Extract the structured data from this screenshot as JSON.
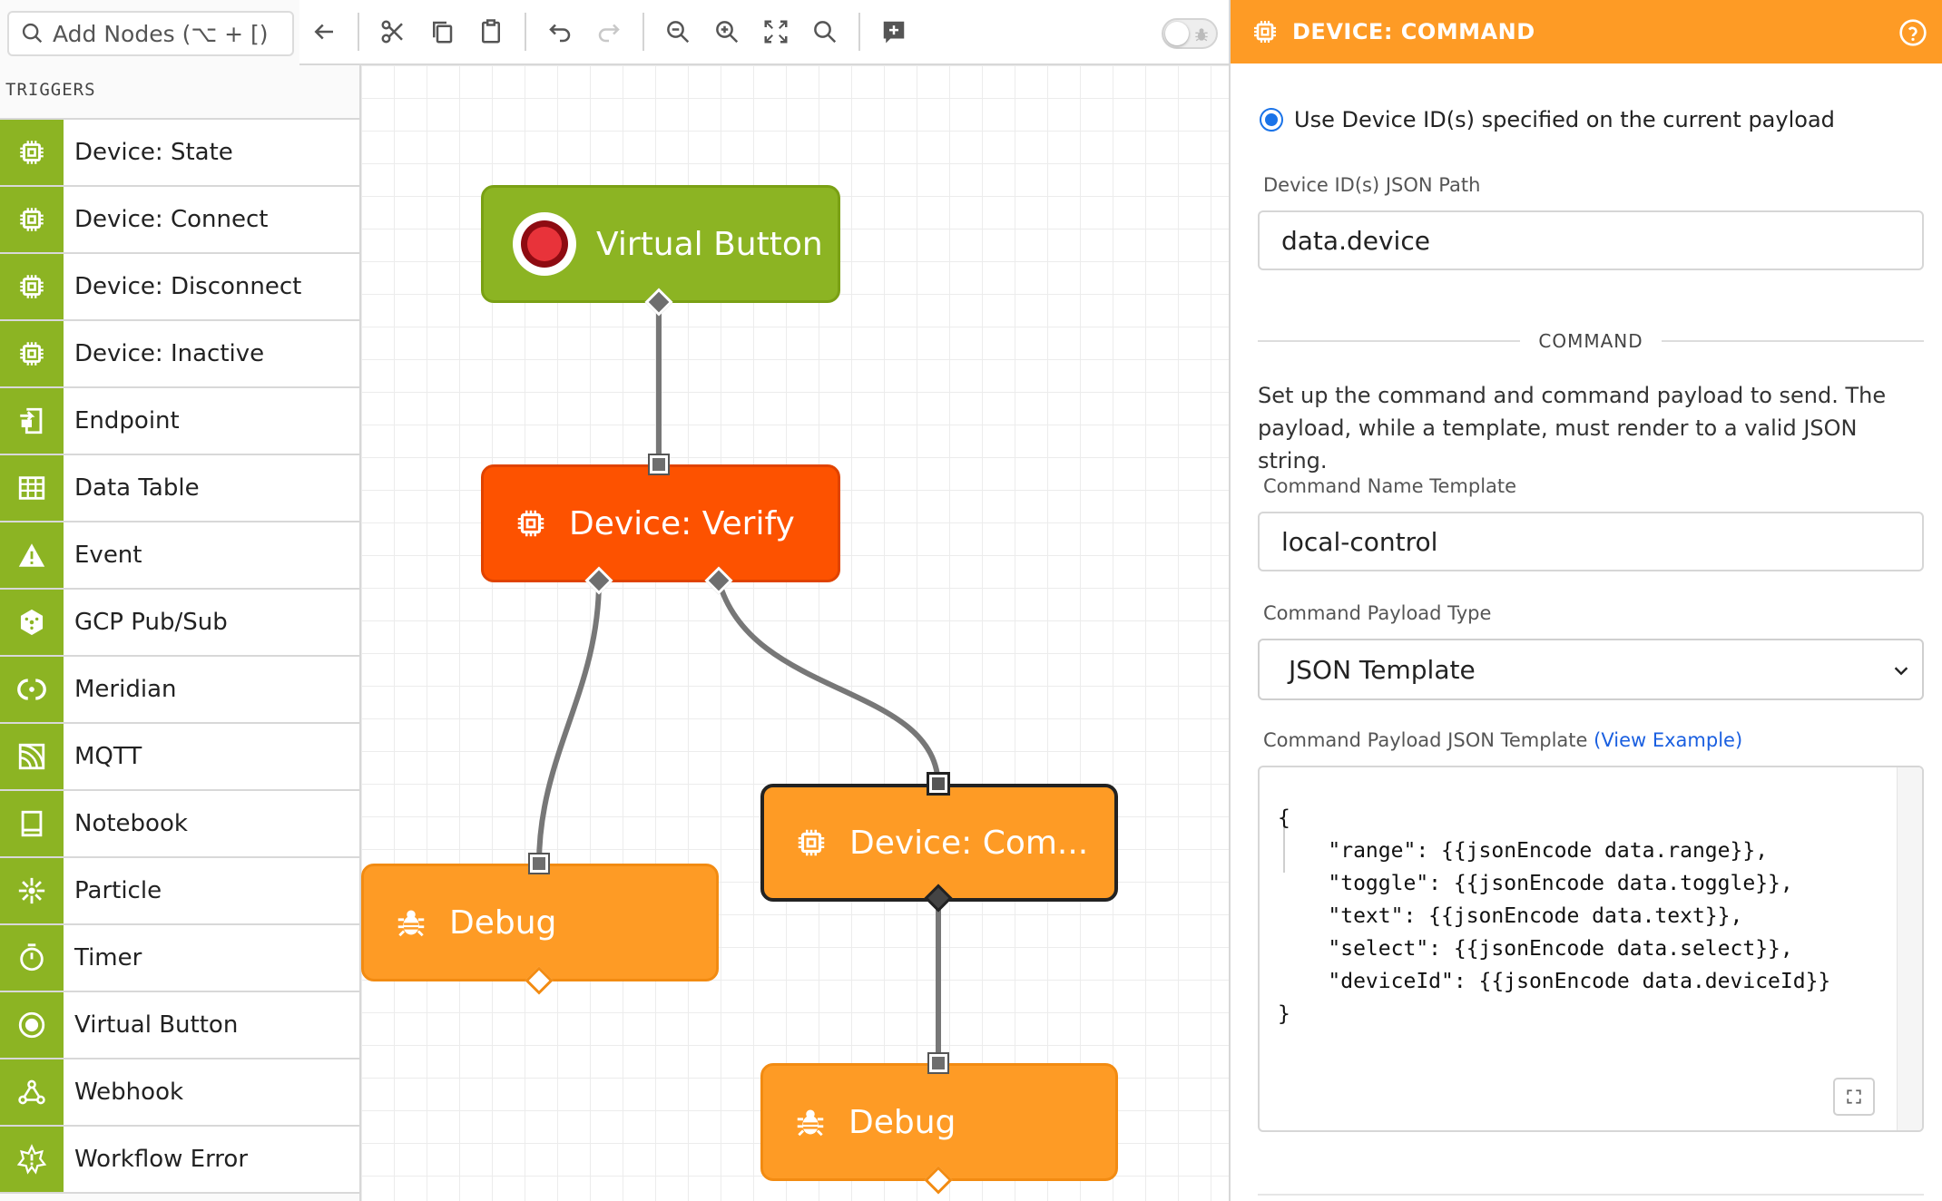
{
  "search": {
    "placeholder": "Add Nodes (⌥ + [)"
  },
  "palette": {
    "section": "TRIGGERS",
    "items": [
      {
        "label": "Device: State",
        "icon": "device-chip-icon"
      },
      {
        "label": "Device: Connect",
        "icon": "device-chip-icon"
      },
      {
        "label": "Device: Disconnect",
        "icon": "device-chip-icon"
      },
      {
        "label": "Device: Inactive",
        "icon": "device-chip-icon"
      },
      {
        "label": "Endpoint",
        "icon": "endpoint-icon"
      },
      {
        "label": "Data Table",
        "icon": "table-icon"
      },
      {
        "label": "Event",
        "icon": "warning-icon"
      },
      {
        "label": "GCP Pub/Sub",
        "icon": "gcp-icon"
      },
      {
        "label": "Meridian",
        "icon": "meridian-icon"
      },
      {
        "label": "MQTT",
        "icon": "mqtt-icon"
      },
      {
        "label": "Notebook",
        "icon": "notebook-icon"
      },
      {
        "label": "Particle",
        "icon": "particle-icon"
      },
      {
        "label": "Timer",
        "icon": "timer-icon"
      },
      {
        "label": "Virtual Button",
        "icon": "virtual-button-icon"
      },
      {
        "label": "Webhook",
        "icon": "webhook-icon"
      },
      {
        "label": "Workflow Error",
        "icon": "workflow-error-icon"
      }
    ]
  },
  "canvas": {
    "nodes": {
      "virtual_button": "Virtual Button",
      "device_verify": "Device: Verify",
      "debug_left": "Debug",
      "device_command": "Device: Com...",
      "debug_bottom": "Debug"
    }
  },
  "panel": {
    "title": "DEVICE: COMMAND",
    "radio_label": "Use Device ID(s) specified on the current payload",
    "device_path_label": "Device ID(s) JSON Path",
    "device_path_value": "data.device",
    "section_command": "COMMAND",
    "command_description": "Set up the command and command payload to send. The payload, while a template, must render to a valid JSON string.",
    "command_name_label": "Command Name Template",
    "command_name_value": "local-control",
    "payload_type_label": "Command Payload Type",
    "payload_type_value": "JSON Template",
    "payload_template_label": "Command Payload JSON Template",
    "view_example": "(View Example)",
    "payload_template_code": "{\n    \"range\": {{jsonEncode data.range}},\n    \"toggle\": {{jsonEncode data.toggle}},\n    \"text\": {{jsonEncode data.text}},\n    \"select\": {{jsonEncode data.select}},\n    \"deviceId\": {{jsonEncode data.deviceId}}\n}"
  },
  "colors": {
    "trigger_green": "#8cb423",
    "verify_red": "#fd5200",
    "output_orange": "#fe9b25",
    "link_blue": "#1a5fe0"
  }
}
